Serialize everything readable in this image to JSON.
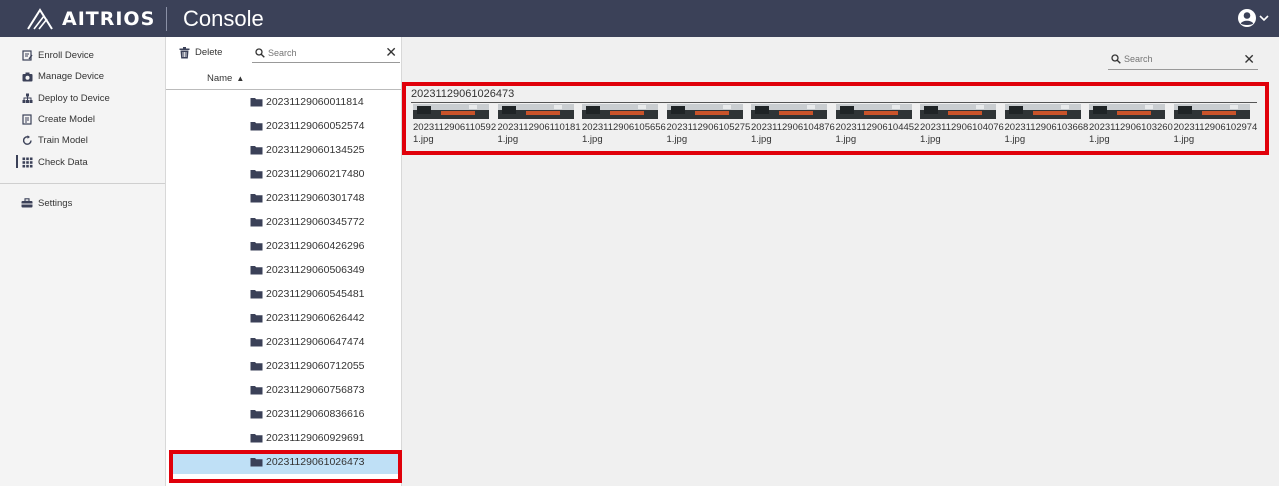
{
  "header": {
    "brand": "AITRIOS",
    "app_title": "Console"
  },
  "sidebar": {
    "items": [
      {
        "label": "Enroll Device",
        "icon": "enroll-icon"
      },
      {
        "label": "Manage Device",
        "icon": "camera-icon"
      },
      {
        "label": "Deploy to Device",
        "icon": "deploy-icon"
      },
      {
        "label": "Create Model",
        "icon": "create-model-icon"
      },
      {
        "label": "Train Model",
        "icon": "train-icon"
      },
      {
        "label": "Check Data",
        "icon": "grid-icon",
        "active": true
      }
    ],
    "settings_label": "Settings"
  },
  "folders": {
    "delete_label": "Delete",
    "search_placeholder": "Search",
    "column_header": "Name",
    "items": [
      "20231129060011814",
      "20231129060052574",
      "20231129060134525",
      "20231129060217480",
      "20231129060301748",
      "20231129060345772",
      "20231129060426296",
      "20231129060506349",
      "20231129060545481",
      "20231129060626442",
      "20231129060647474",
      "20231129060712055",
      "20231129060756873",
      "20231129060836616",
      "20231129060929691",
      "20231129061026473"
    ],
    "selected": "20231129061026473"
  },
  "main": {
    "search_placeholder": "Search",
    "gallery_title": "20231129061026473",
    "images": [
      "20231129061105921.jpg",
      "20231129061101811.jpg",
      "20231129061056561.jpg",
      "20231129061052751.jpg",
      "20231129061048761.jpg",
      "20231129061044521.jpg",
      "20231129061040761.jpg",
      "20231129061036681.jpg",
      "20231129061032601.jpg",
      "20231129061029741.jpg"
    ]
  },
  "colors": {
    "header_bg": "#3b4158",
    "highlight": "#e0000a",
    "selected_row": "#bfe0f6"
  }
}
